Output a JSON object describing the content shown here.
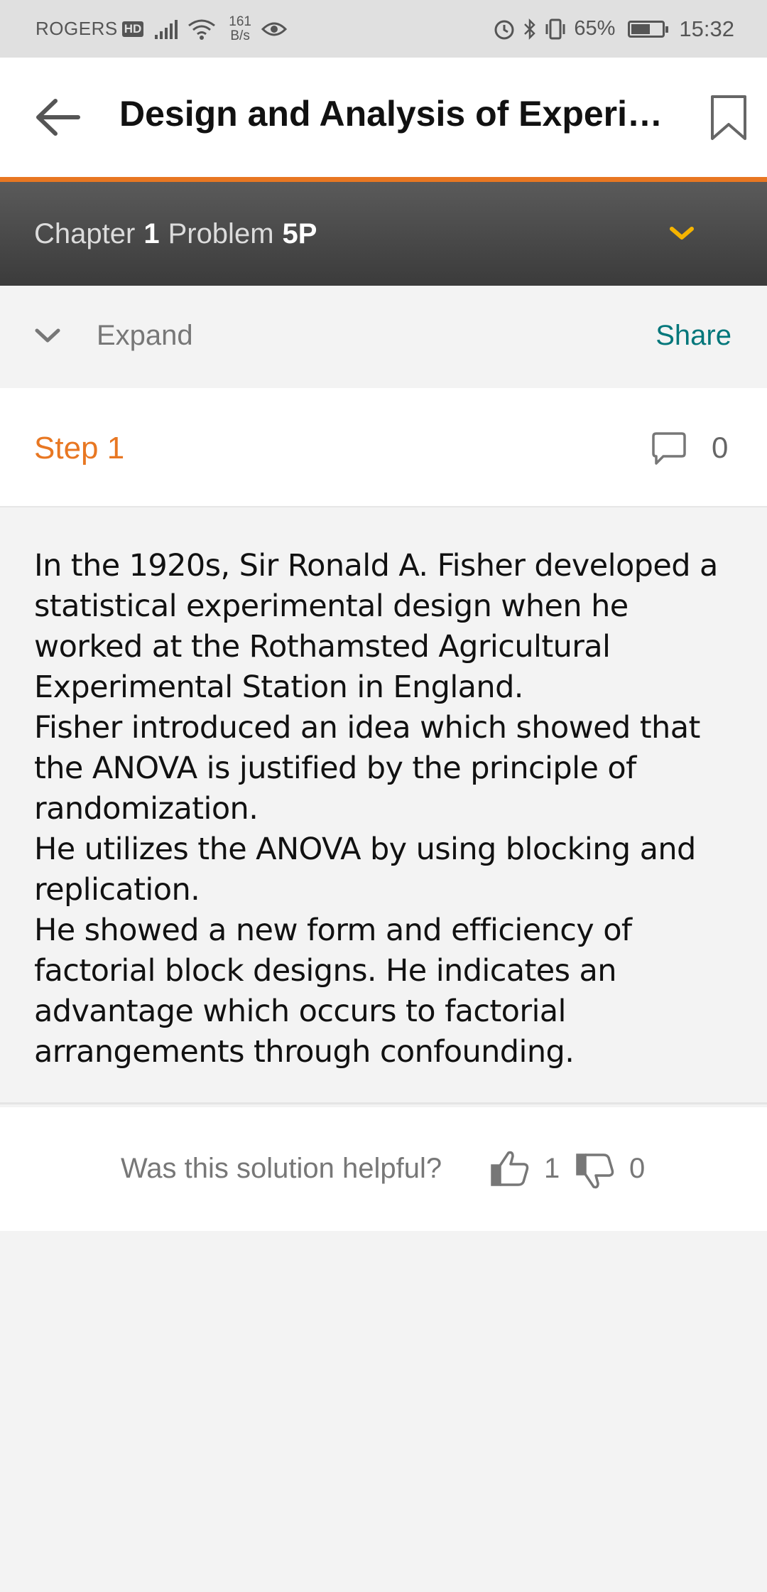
{
  "status_bar": {
    "carrier": "ROGERS",
    "hd_badge": "HD",
    "net_speed_value": "161",
    "net_speed_unit": "B/s",
    "battery_percent": "65%",
    "battery_level": 0.65,
    "time": "15:32",
    "icons": [
      "signal-icon",
      "wifi-icon",
      "eye-icon",
      "alarm-icon",
      "bluetooth-icon",
      "vibrate-icon",
      "battery-icon"
    ]
  },
  "header": {
    "title": "Design and Analysis of Experi…",
    "icons": [
      "back-arrow-icon",
      "bookmark-icon"
    ]
  },
  "chapter_bar": {
    "chapter_label": "Chapter",
    "chapter_number": "1",
    "problem_label": "Problem",
    "problem_number": "5P",
    "dropdown_color": "#f5b400"
  },
  "toolbar": {
    "expand_label": "Expand",
    "share_label": "Share"
  },
  "step": {
    "title": "Step 1",
    "comment_count": "0",
    "paragraphs": [
      "In the 1920s, Sir Ronald A. Fisher developed a statistical experimental design when he worked at the Rothamsted Agricultural Experimental Station in England.",
      "Fisher introduced an idea which showed that the ANOVA is justified by the principle of randomization.",
      "He utilizes the ANOVA by using blocking and replication.",
      "He showed a new form and efficiency of factorial block designs. He indicates an advantage which occurs to factorial arrangements through confounding."
    ]
  },
  "feedback": {
    "question": "Was this solution helpful?",
    "upvotes": "1",
    "downvotes": "0"
  },
  "colors": {
    "accent_orange": "#e87722",
    "share_teal": "#00767a",
    "chapter_bar_dark": "#3b3b3b"
  }
}
